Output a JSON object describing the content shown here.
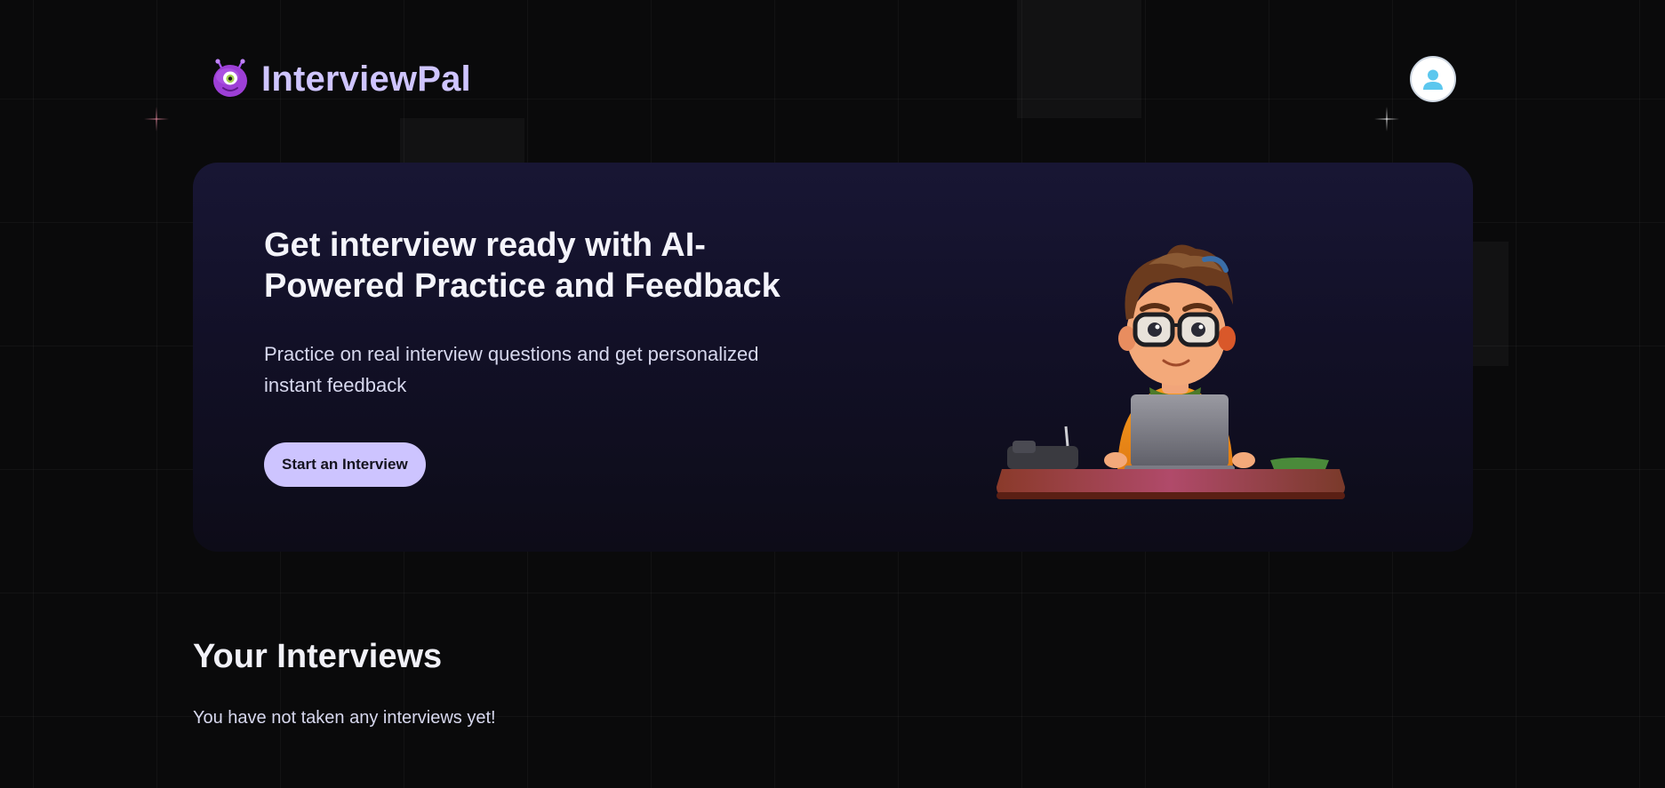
{
  "header": {
    "brand_name": "InterviewPal",
    "logo_icon": "alien-mascot-icon",
    "profile_icon": "user-avatar-icon"
  },
  "hero": {
    "title": "Get interview ready with AI-Powered Practice and Feedback",
    "subtitle": "Practice on real interview questions and get personalized instant feedback",
    "cta_label": "Start an Interview",
    "illustration": "developer-at-laptop-illustration"
  },
  "interviews_section": {
    "title": "Your Interviews",
    "empty_message": "You have not taken any interviews yet!"
  },
  "colors": {
    "brand_text": "#cfc5ff",
    "cta_background": "#cdc4ff",
    "hero_background": "#181634",
    "page_background": "#0a0a0b"
  }
}
